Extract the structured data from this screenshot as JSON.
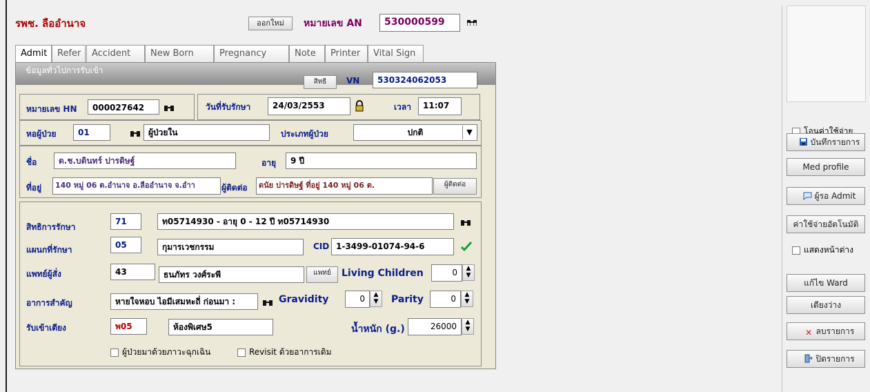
{
  "header": {
    "hospital": "รพช. ลืออำนาจ",
    "new_btn": "ออกใหม่",
    "an_label": "หมายเลข AN",
    "an_value": "530000599"
  },
  "tabs": [
    "Admit",
    "Refer",
    "Accident",
    "New Born",
    "Pregnancy",
    "Note",
    "Printer",
    "Vital Sign"
  ],
  "panel": {
    "section_title": "ข้อมูลทั่วไปการรับเข้า",
    "rights_btn": "สิทธิ",
    "vn_label": "VN",
    "vn_value": "530324062053",
    "hn_label": "หมายเลข HN",
    "hn_value": "000027642",
    "date_label": "วันที่รับรักษา",
    "date_value": "24/03/2553",
    "time_label": "เวลา",
    "time_value": "11:07",
    "ward_label": "หอผู้ป่วย",
    "ward_code": "01",
    "ward_name": "ผู้ป่วยใน",
    "patient_type_label": "ประเภทผู้ป่วย",
    "patient_type_value": "ปกติ",
    "name_label": "ชื่อ",
    "name_value": "ด.ช.บดินทร์ ปารดิษฐ์",
    "age_label": "อายุ",
    "age_value": "9 ปี",
    "address_label": "ที่อยู่",
    "address_value": "140 หมู่ 06 ต.อำนาจ อ.ลืออำนาจ จ.อำา",
    "contact_label": "ผู้ติดต่อ",
    "contact_value": "ดนัย ปารดิษฐ์ ที่อยู่ 140 หมู่ 06 ต.",
    "contact_btn": "ผู้ติดต่อ",
    "rights_label": "สิทธิการรักษา",
    "rights_code": "71",
    "rights_value": "ท05714930 - อายุ 0 - 12 ปี ท05714930",
    "dept_label": "แผนกที่รักษา",
    "dept_code": "05",
    "dept_value": "กุมารเวชกรรม",
    "cid_label": "CID",
    "cid_value": "1-3499-01074-94-6",
    "doctor_label": "แพทย์ผู้สั่ง",
    "doctor_code": "43",
    "doctor_name": "ธนภัทร วงศ์ระพี",
    "doctor_btn": "แพทย์",
    "living_label": "Living Children",
    "living_value": "0",
    "symptom_label": "อาการสำคัญ",
    "symptom_value": "หายใจหอบ ไอมีเสมหะถี่ ก่อนมา :",
    "gravidity_label": "Gravidity",
    "gravidity_value": "0",
    "parity_label": "Parity",
    "parity_value": "0",
    "bed_label": "รับเข้าเตียง",
    "bed_code": "พ05",
    "bed_name": "ห้องพิเศษ5",
    "weight_label": "น้ำหนัก (g.)",
    "weight_value": "26000",
    "emergency_label": "ผู้ป่วยมาด้วยภาวะฉุกเฉิน",
    "revisit_label": "Revisit ด้วยอาการเดิม"
  },
  "side": {
    "transfer_label": "โอนค่าใช้จ่าย",
    "save_btn": "บันทึกรายการ",
    "med_btn": "Med profile",
    "waiting_btn": "ผู้รอ Admit",
    "auto_btn": "ค่าใช้จ่ายอัตโนมัติ",
    "show_window_label": "แสดงหน้าต่าง",
    "edit_ward_btn": "แก้ไข Ward",
    "empty_bed_btn": "เตียงว่าง",
    "delete_btn": "ลบรายการ",
    "close_btn": "ปิดรายการ"
  }
}
